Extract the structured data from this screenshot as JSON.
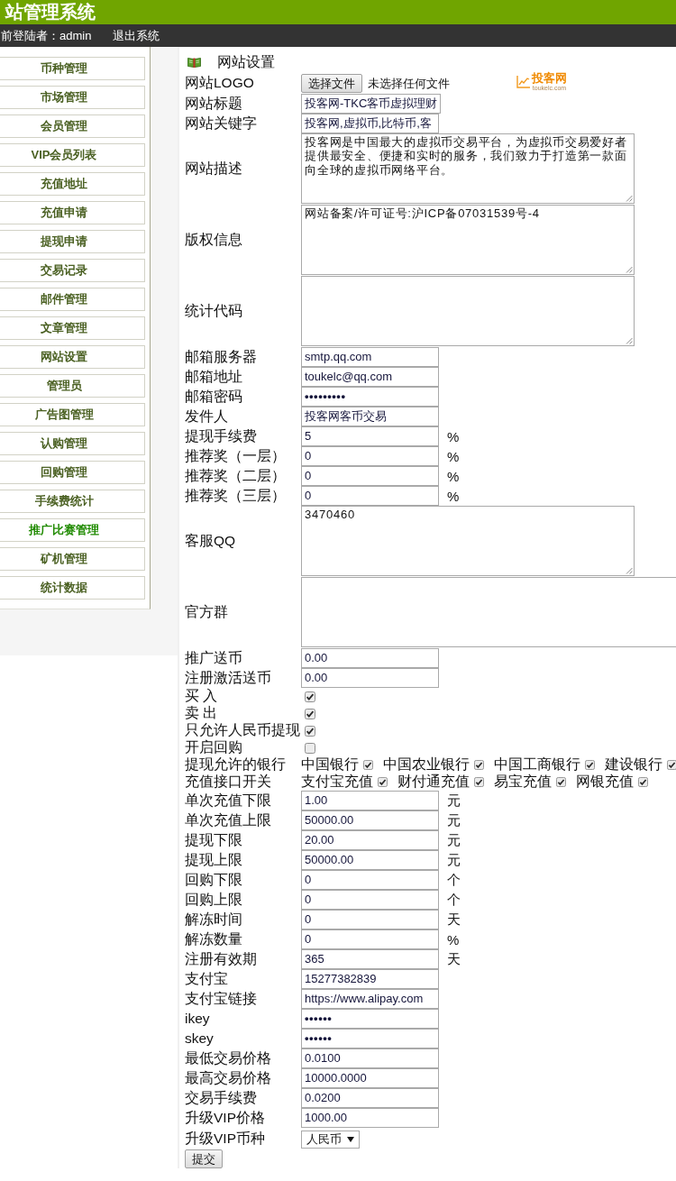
{
  "header": {
    "title": "站管理系统"
  },
  "topbar": {
    "user": "前登陆者：admin",
    "logout": "退出系统"
  },
  "sidebar": {
    "items": [
      {
        "label": "币种管理",
        "selected": false
      },
      {
        "label": "市场管理",
        "selected": false
      },
      {
        "label": "会员管理",
        "selected": false
      },
      {
        "label": "VIP会员列表",
        "selected": false
      },
      {
        "label": "充值地址",
        "selected": false
      },
      {
        "label": "充值申请",
        "selected": false
      },
      {
        "label": "提现申请",
        "selected": false
      },
      {
        "label": "交易记录",
        "selected": false
      },
      {
        "label": "邮件管理",
        "selected": false
      },
      {
        "label": "文章管理",
        "selected": false
      },
      {
        "label": "网站设置",
        "selected": false
      },
      {
        "label": "管理员",
        "selected": false
      },
      {
        "label": "广告图管理",
        "selected": false
      },
      {
        "label": "认购管理",
        "selected": false
      },
      {
        "label": "回购管理",
        "selected": false
      },
      {
        "label": "手续费统计",
        "selected": false
      },
      {
        "label": "推广比赛管理",
        "selected": true
      },
      {
        "label": "矿机管理",
        "selected": false
      },
      {
        "label": "统计数据",
        "selected": false
      }
    ]
  },
  "page": {
    "title": "网站设置"
  },
  "form": {
    "rows": [
      {
        "kind": "file",
        "label": "网站LOGO",
        "button": "选择文件",
        "status": "未选择任何文件",
        "logo": {
          "name": "投客网",
          "domain": "toukelc.com"
        }
      },
      {
        "kind": "text",
        "label": "网站标题",
        "value": "投客网-TKC客币虚拟理财"
      },
      {
        "kind": "text",
        "label": "网站关键字",
        "value": "投客网,虚拟币,比特币,客"
      },
      {
        "kind": "textarea",
        "label": "网站描述",
        "value": "投客网是中国最大的虚拟币交易平台，为虚拟币交易爱好者提供最安全、便捷和实时的服务，我们致力于打造第一款面向全球的虚拟币网络平台。"
      },
      {
        "kind": "textarea",
        "label": "版权信息",
        "value": "网站备案/许可证号:沪ICP备07031539号-4"
      },
      {
        "kind": "textarea",
        "label": "统计代码"
      },
      {
        "kind": "text",
        "label": "邮箱服务器",
        "value": "smtp.qq.com"
      },
      {
        "kind": "text",
        "label": "邮箱地址",
        "value": "toukelc@qq.com"
      },
      {
        "kind": "password",
        "label": "邮箱密码",
        "value": "•••••••••"
      },
      {
        "kind": "text",
        "label": "发件人",
        "value": "投客网客币交易"
      },
      {
        "kind": "text",
        "label": "提现手续费",
        "value": "5",
        "unit": "%"
      },
      {
        "kind": "text",
        "label": "推荐奖（一层）",
        "value": "0",
        "unit": "%"
      },
      {
        "kind": "text",
        "label": "推荐奖（二层）",
        "value": "0",
        "unit": "%"
      },
      {
        "kind": "text",
        "label": "推荐奖（三层）",
        "value": "0",
        "unit": "%"
      },
      {
        "kind": "textarea",
        "label": "客服QQ",
        "value": "3470460"
      },
      {
        "kind": "wide-textarea",
        "label": "官方群"
      },
      {
        "kind": "text",
        "label": "推广送币",
        "value": "0.00"
      },
      {
        "kind": "text",
        "label": "注册激活送币",
        "value": "0.00"
      },
      {
        "kind": "checkbox",
        "label": "买 入",
        "checked": true
      },
      {
        "kind": "checkbox",
        "label": "卖 出",
        "checked": true
      },
      {
        "kind": "checkbox",
        "label": "只允许人民币提现",
        "checked": true
      },
      {
        "kind": "checkbox",
        "label": "开启回购",
        "checked": false
      },
      {
        "kind": "options",
        "label": "提现允许的银行",
        "options": [
          {
            "label": "中国银行",
            "checked": true
          },
          {
            "label": "中国农业银行",
            "checked": true
          },
          {
            "label": "中国工商银行",
            "checked": true
          },
          {
            "label": "建设银行",
            "checked": true
          }
        ]
      },
      {
        "kind": "options",
        "label": "充值接口开关",
        "options": [
          {
            "label": "支付宝充值",
            "checked": true
          },
          {
            "label": "财付通充值",
            "checked": true
          },
          {
            "label": "易宝充值",
            "checked": true
          },
          {
            "label": "网银充值",
            "checked": true
          }
        ]
      },
      {
        "kind": "text",
        "label": "单次充值下限",
        "value": "1.00",
        "unit": "元"
      },
      {
        "kind": "text",
        "label": "单次充值上限",
        "value": "50000.00",
        "unit": "元"
      },
      {
        "kind": "text",
        "label": "提现下限",
        "value": "20.00",
        "unit": "元"
      },
      {
        "kind": "text",
        "label": "提现上限",
        "value": "50000.00",
        "unit": "元"
      },
      {
        "kind": "text",
        "label": "回购下限",
        "value": "0",
        "unit": "个"
      },
      {
        "kind": "text",
        "label": "回购上限",
        "value": "0",
        "unit": "个"
      },
      {
        "kind": "text",
        "label": "解冻时间",
        "value": "0",
        "unit": "天"
      },
      {
        "kind": "text",
        "label": "解冻数量",
        "value": "0",
        "unit": "%"
      },
      {
        "kind": "text",
        "label": "注册有效期",
        "value": "365",
        "unit": "天"
      },
      {
        "kind": "text",
        "label": "支付宝",
        "value": "15277382839"
      },
      {
        "kind": "text",
        "label": "支付宝链接",
        "value": "https://www.alipay.com"
      },
      {
        "kind": "password",
        "label": "ikey",
        "value": "••••••"
      },
      {
        "kind": "password",
        "label": "skey",
        "value": "••••••"
      },
      {
        "kind": "text",
        "label": "最低交易价格",
        "value": "0.0100"
      },
      {
        "kind": "text",
        "label": "最高交易价格",
        "value": "10000.0000"
      },
      {
        "kind": "text",
        "label": "交易手续费",
        "value": "0.0200"
      },
      {
        "kind": "text",
        "label": "升级VIP价格",
        "value": "1000.00"
      },
      {
        "kind": "select",
        "label": "升级VIP币种",
        "value": "人民币"
      }
    ],
    "submit": "提交"
  }
}
